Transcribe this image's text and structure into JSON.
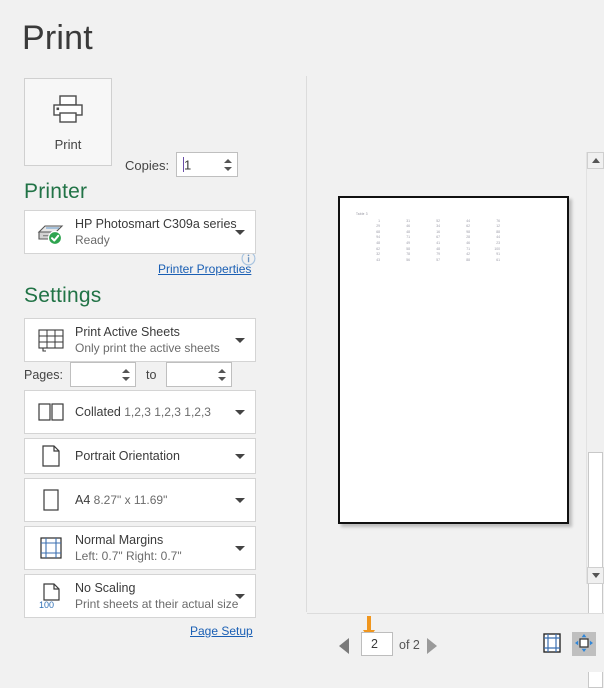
{
  "page_title": "Print",
  "print_button": {
    "label": "Print",
    "icon": "printer-icon"
  },
  "copies": {
    "label": "Copies:",
    "value": "1"
  },
  "printer": {
    "heading": "Printer",
    "info_icon": "info-icon",
    "name": "HP Photosmart C309a series",
    "status": "Ready",
    "status_icon": "green-check-icon",
    "properties_link": "Printer Properties"
  },
  "settings": {
    "heading": "Settings",
    "page_setup_link": "Page Setup",
    "pages": {
      "label": "Pages:",
      "to_label": "to",
      "from_value": "",
      "to_value": ""
    },
    "options": [
      {
        "name": "print-area",
        "icon": "spreadsheet-grid-icon",
        "primary": "Print Active Sheets",
        "secondary": "Only print the active sheets"
      },
      {
        "name": "collation",
        "icon": "collate-pages-icon",
        "primary": "Collated",
        "secondary": "1,2,3   1,2,3   1,2,3"
      },
      {
        "name": "orientation",
        "icon": "portrait-page-icon",
        "primary": "Portrait Orientation",
        "secondary": ""
      },
      {
        "name": "paper-size",
        "icon": "paper-size-icon",
        "primary": "A4",
        "secondary": "8.27\" x 11.69\""
      },
      {
        "name": "margins",
        "icon": "margins-grid-icon",
        "primary": "Normal Margins",
        "secondary": "Left:  0.7\"   Right:  0.7\""
      },
      {
        "name": "scaling",
        "icon": "scaling-100-icon",
        "primary": "No Scaling",
        "secondary": "Print sheets at their actual size",
        "badge": "100"
      }
    ]
  },
  "preview": {
    "page_number": "2",
    "page_count_label": "of 2",
    "prev_icon": "left-triangle-icon",
    "next_icon": "right-triangle-icon",
    "show_margins_icon": "show-margins-icon",
    "zoom_to_page_icon": "zoom-to-page-icon",
    "scroll_up_icon": "scroll-up-arrow-icon",
    "scroll_down_icon": "scroll-down-arrow-icon",
    "sheet": {
      "title": "Table 3",
      "rows": [
        [
          "1",
          "31",
          "52",
          "44",
          "76"
        ],
        [
          "29",
          "46",
          "34",
          "62",
          "12"
        ],
        [
          "68",
          "48",
          "16",
          "98",
          "88"
        ],
        [
          "94",
          "71",
          "67",
          "28",
          "44"
        ],
        [
          "48",
          "49",
          "41",
          "46",
          "23"
        ],
        [
          "62",
          "58",
          "48",
          "71",
          "100"
        ],
        [
          "32",
          "78",
          "79",
          "42",
          "91"
        ],
        [
          "43",
          "56",
          "57",
          "88",
          "61"
        ]
      ]
    }
  },
  "colors": {
    "accent_green": "#217346",
    "link_blue": "#1a5fb4",
    "annotation_orange": "#f0961e",
    "status_green": "#2ea44f"
  }
}
